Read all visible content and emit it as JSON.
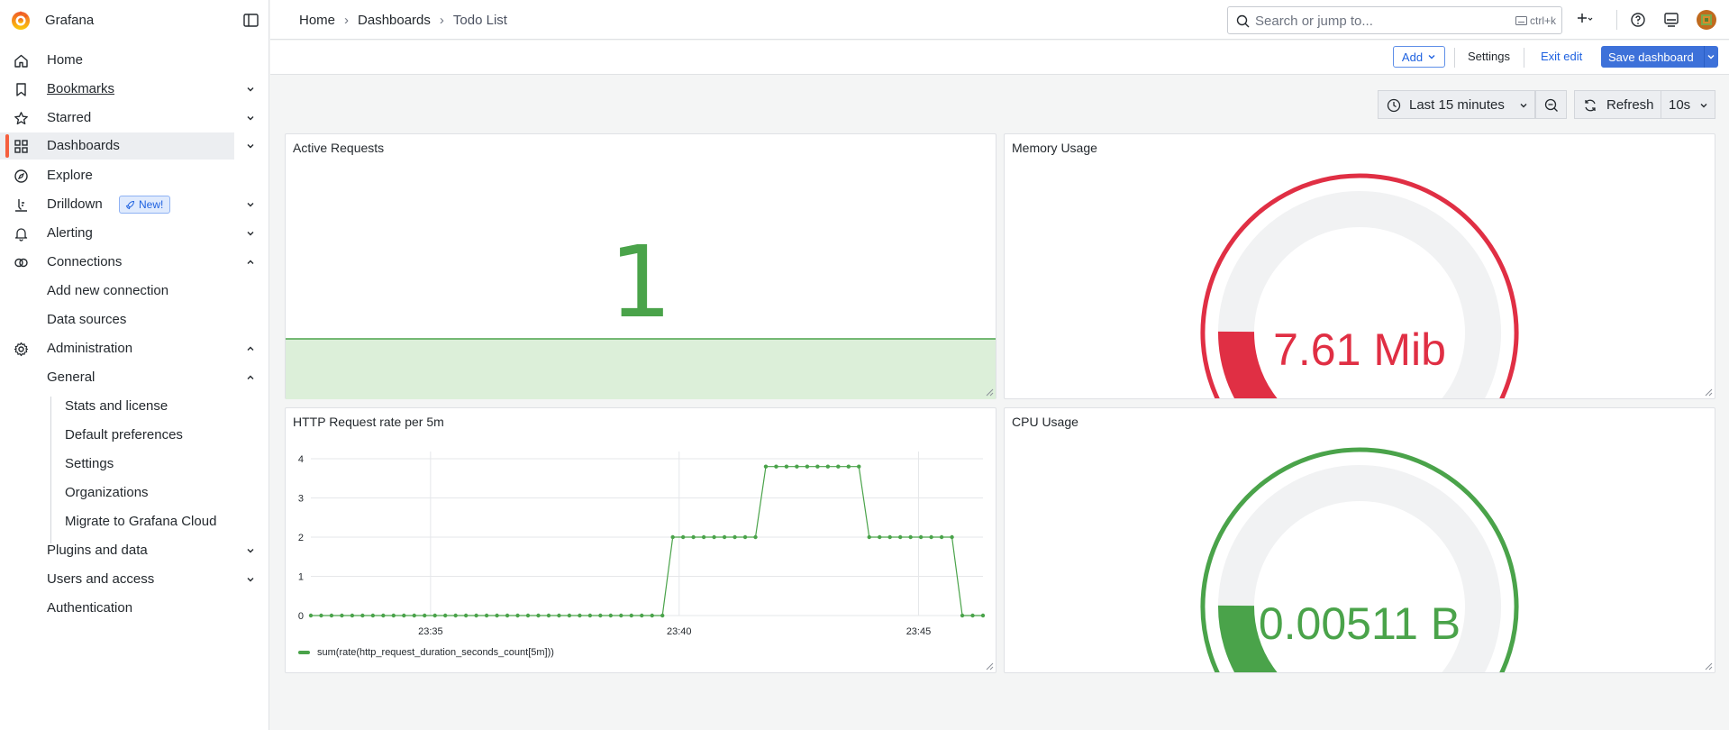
{
  "app": {
    "name": "Grafana"
  },
  "sidebar": {
    "items": [
      {
        "label": "Home"
      },
      {
        "label": "Bookmarks"
      },
      {
        "label": "Starred"
      },
      {
        "label": "Dashboards"
      },
      {
        "label": "Explore"
      },
      {
        "label": "Drilldown",
        "badge": "New!"
      },
      {
        "label": "Alerting"
      },
      {
        "label": "Connections"
      },
      {
        "label": "Add new connection"
      },
      {
        "label": "Data sources"
      },
      {
        "label": "Administration"
      },
      {
        "label": "General"
      },
      {
        "label": "Stats and license"
      },
      {
        "label": "Default preferences"
      },
      {
        "label": "Settings"
      },
      {
        "label": "Organizations"
      },
      {
        "label": "Migrate to Grafana Cloud"
      },
      {
        "label": "Plugins and data"
      },
      {
        "label": "Users and access"
      },
      {
        "label": "Authentication"
      }
    ]
  },
  "breadcrumb": {
    "home": "Home",
    "dashboards": "Dashboards",
    "current": "Todo List"
  },
  "search": {
    "placeholder": "Search or jump to...",
    "shortcut": "ctrl+k"
  },
  "toolbar": {
    "add_label": "Add",
    "settings_label": "Settings",
    "exit_label": "Exit edit",
    "save_label": "Save dashboard"
  },
  "timecontrols": {
    "range": "Last 15 minutes",
    "refresh": "Refresh",
    "interval": "10s"
  },
  "colors": {
    "accent": "#3d71d9",
    "green": "#4aa34a",
    "red": "#e02f44"
  },
  "panels": {
    "active_requests": {
      "title": "Active Requests",
      "value": "1"
    },
    "memory": {
      "title": "Memory Usage",
      "value": "7.61 Mib",
      "fraction": 0.22
    },
    "http": {
      "title": "HTTP Request rate per 5m",
      "legend": "sum(rate(http_request_duration_seconds_count[5m]))"
    },
    "cpu": {
      "title": "CPU Usage",
      "value": "0.00511 B",
      "fraction": 0.22
    }
  },
  "chart_data": {
    "type": "line",
    "title": "HTTP Request rate per 5m",
    "ylim": [
      0,
      4
    ],
    "yticks": [
      "0",
      "1",
      "2",
      "3",
      "4"
    ],
    "xticks": [
      "23:35",
      "23:40",
      "23:45"
    ],
    "grid": true,
    "legend_placement": "bottom-left",
    "series": [
      {
        "name": "sum(rate(http_request_duration_seconds_count[5m]))",
        "values": [
          0,
          0,
          0,
          0,
          0,
          0,
          0,
          0,
          0,
          0,
          0,
          0,
          0,
          0,
          0,
          0,
          0,
          0,
          0,
          0,
          0,
          0,
          0,
          0,
          0,
          0,
          0,
          0,
          0,
          0,
          0,
          0,
          0,
          0,
          0,
          2,
          2,
          2,
          2,
          2,
          2,
          2,
          2,
          2,
          3.8,
          3.8,
          3.8,
          3.8,
          3.8,
          3.8,
          3.8,
          3.8,
          3.8,
          3.8,
          2,
          2,
          2,
          2,
          2,
          2,
          2,
          2,
          2,
          0,
          0,
          0
        ]
      }
    ]
  }
}
